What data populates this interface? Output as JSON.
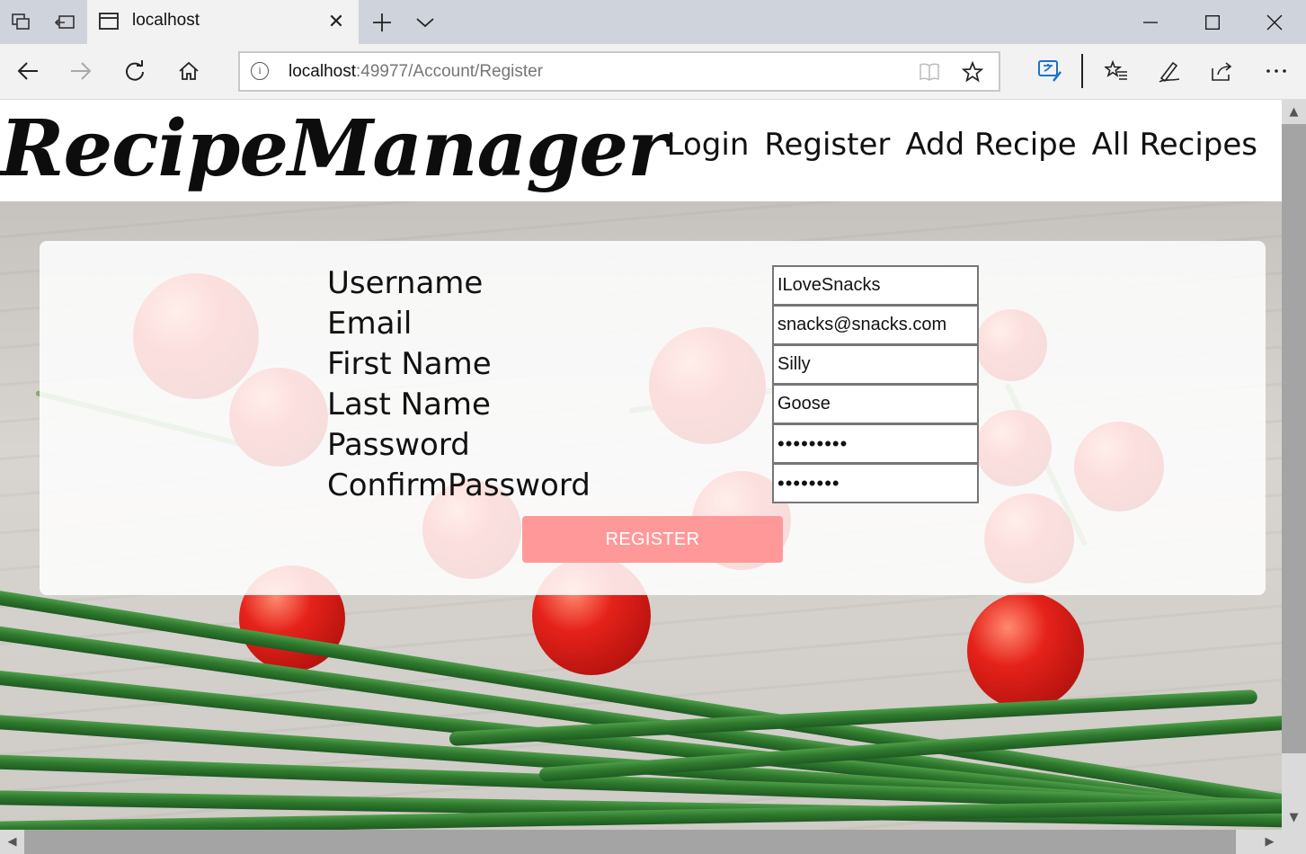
{
  "browser": {
    "tab_title": "localhost",
    "address_host": "localhost",
    "address_path": ":49977/Account/Register"
  },
  "site": {
    "logo": "RecipeManager",
    "nav": [
      {
        "label": "Login"
      },
      {
        "label": "Register"
      },
      {
        "label": "Add Recipe"
      },
      {
        "label": "All Recipes"
      }
    ]
  },
  "form": {
    "fields": [
      {
        "label": "Username",
        "value": "ILoveSnacks",
        "type": "text"
      },
      {
        "label": "Email",
        "value": "snacks@snacks.com",
        "type": "text"
      },
      {
        "label": "First Name",
        "value": "Silly",
        "type": "text"
      },
      {
        "label": "Last Name",
        "value": "Goose",
        "type": "text"
      },
      {
        "label": "Password",
        "value": "123456789",
        "type": "password"
      },
      {
        "label": "ConfirmPassword",
        "value": "12345678",
        "type": "password"
      }
    ],
    "submit_label": "REGISTER"
  },
  "colors": {
    "register_button": "#ff9999",
    "tab_bar": "#cfd3dc",
    "toolbar": "#f2f2f2"
  },
  "icons": {
    "titlebar": [
      "set-aside-tabs-icon",
      "restore-tabs-icon",
      "new-tab-icon",
      "tab-list-chevron-icon",
      "minimize-icon",
      "maximize-icon",
      "close-window-icon"
    ],
    "navbar": [
      "back-icon",
      "forward-icon",
      "refresh-icon",
      "home-icon",
      "info-icon",
      "reading-view-icon",
      "favorite-star-icon",
      "translate-icon",
      "favorites-hub-icon",
      "pen-icon",
      "share-icon",
      "more-icon"
    ]
  }
}
